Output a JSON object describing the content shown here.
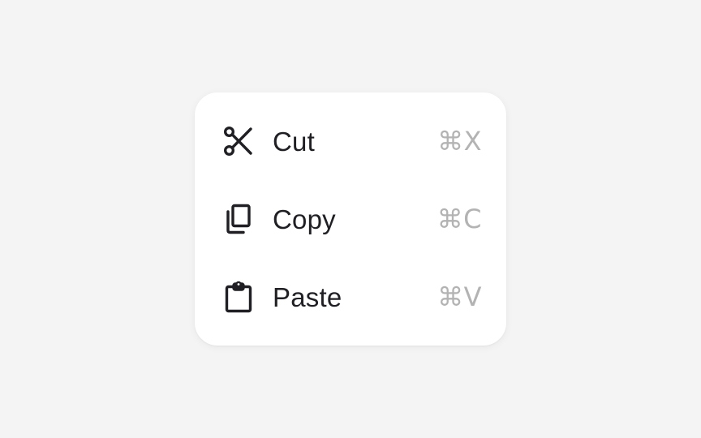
{
  "colors": {
    "background": "#f4f4f4",
    "menu_background": "#ffffff",
    "label_text": "#1f1f24",
    "shortcut_text": "#b3b3b3",
    "icon_stroke": "#1f1f24"
  },
  "context_menu": {
    "items": [
      {
        "icon": "scissors-icon",
        "label": "Cut",
        "shortcut": "⌘X"
      },
      {
        "icon": "copy-icon",
        "label": "Copy",
        "shortcut": "⌘C"
      },
      {
        "icon": "clipboard-icon",
        "label": "Paste",
        "shortcut": "⌘V"
      }
    ]
  }
}
